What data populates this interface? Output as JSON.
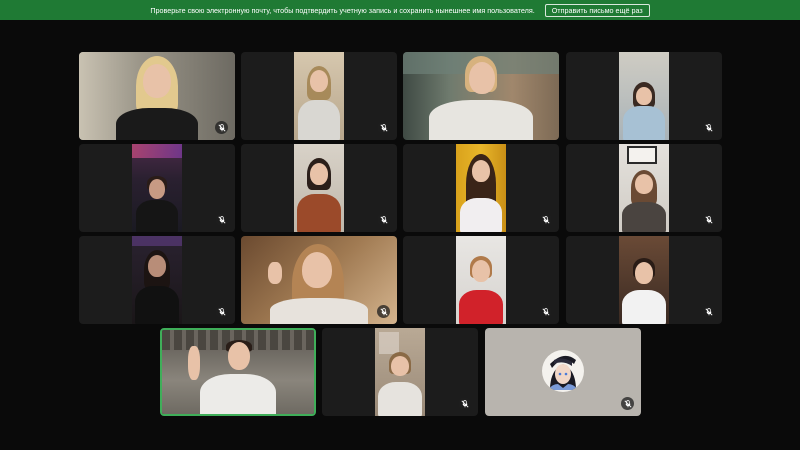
{
  "banner": {
    "message": "Проверьте свою электронную почту, чтобы подтвердить учетную запись и сохранить нынешнее имя пользователя.",
    "button_label": "Отправить письмо ещё раз"
  },
  "colors": {
    "banner_bg": "#1f7a34",
    "active_speaker_border": "#3fae59",
    "tile_bg": "#1c1c1c",
    "avatar_tile_bg": "#b8b4ae"
  },
  "icons": {
    "mute": "microphone-off-icon",
    "avatar": "anime-avatar-icon"
  },
  "participants": [
    {
      "id": "p1",
      "muted": true,
      "active": false
    },
    {
      "id": "p2",
      "muted": true,
      "active": false
    },
    {
      "id": "p3",
      "muted": false,
      "active": false
    },
    {
      "id": "p4",
      "muted": true,
      "active": false
    },
    {
      "id": "p5",
      "muted": true,
      "active": false
    },
    {
      "id": "p6",
      "muted": true,
      "active": false
    },
    {
      "id": "p7",
      "muted": true,
      "active": false
    },
    {
      "id": "p8",
      "muted": true,
      "active": false
    },
    {
      "id": "p9",
      "muted": true,
      "active": false
    },
    {
      "id": "p10",
      "muted": true,
      "active": false
    },
    {
      "id": "p11",
      "muted": true,
      "active": false
    },
    {
      "id": "p12",
      "muted": true,
      "active": false
    },
    {
      "id": "p13",
      "muted": false,
      "active": true
    },
    {
      "id": "p14",
      "muted": true,
      "active": false
    },
    {
      "id": "p15",
      "muted": true,
      "active": false,
      "video_off": true
    }
  ]
}
